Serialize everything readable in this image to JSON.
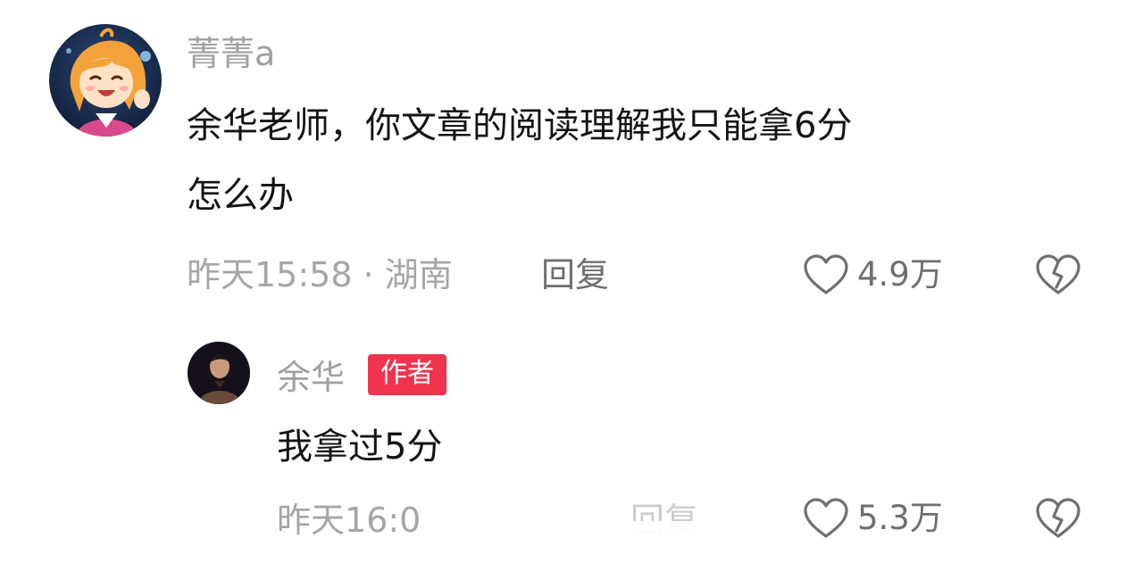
{
  "comments": [
    {
      "username": "菁菁a",
      "text_line1": "余华老师，你文章的阅读理解我只能拿6分",
      "text_line2": "怎么办",
      "meta": "昨天15:58 · 湖南",
      "reply_label": "回复",
      "like_count": "4.9万",
      "avatar_icon": "anime-girl-avatar",
      "like_icon": "heart-outline-icon",
      "dislike_icon": "broken-heart-icon"
    },
    {
      "username": "余华",
      "badge": "作者",
      "text": "我拿过5分",
      "meta": "昨天16:0",
      "reply_label": "回复",
      "like_count": "5.3万",
      "avatar_icon": "man-portrait-avatar",
      "like_icon": "heart-outline-icon",
      "dislike_icon": "broken-heart-icon"
    }
  ],
  "colors": {
    "badge": "#f0344e",
    "username": "#a0a0a0",
    "text": "#141414",
    "meta": "#a6a6a6",
    "icon": "#6f6f6f"
  }
}
